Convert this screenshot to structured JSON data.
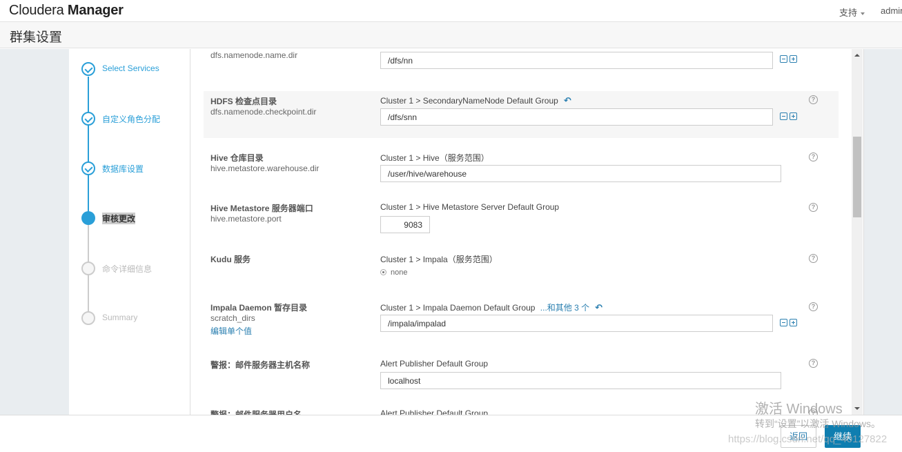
{
  "header": {
    "brand_light": "Cloudera",
    "brand_bold": "Manager",
    "support_menu": "支持",
    "user_menu": "admin"
  },
  "page": {
    "title": "群集设置"
  },
  "wizard": {
    "steps": [
      {
        "label": "Select Services",
        "state": "done"
      },
      {
        "label": "自定义角色分配",
        "state": "done"
      },
      {
        "label": "数据库设置",
        "state": "done"
      },
      {
        "label": "审核更改",
        "state": "current"
      },
      {
        "label": "命令详细信息",
        "state": "todo"
      },
      {
        "label": "Summary",
        "state": "todo"
      }
    ]
  },
  "settings": [
    {
      "name": "",
      "key": "dfs.namenode.name.dir",
      "scope": "",
      "value": "/dfs/nn",
      "multi": true
    },
    {
      "name": "HDFS 检查点目录",
      "key": "dfs.namenode.checkpoint.dir",
      "scope": "Cluster 1 > SecondaryNameNode Default Group",
      "value": "/dfs/snn",
      "multi": true,
      "undo": true
    },
    {
      "name": "Hive 仓库目录",
      "key": "hive.metastore.warehouse.dir",
      "scope": "Cluster 1 > Hive（服务范围）",
      "value": "/user/hive/warehouse"
    },
    {
      "name": "Hive Metastore 服务器端口",
      "key": "hive.metastore.port",
      "scope": "Cluster 1 > Hive Metastore Server Default Group",
      "value": "9083"
    },
    {
      "name": "Kudu 服务",
      "key": "",
      "scope": "Cluster 1 > Impala（服务范围）",
      "radio_option": "none"
    },
    {
      "name": "Impala Daemon 暂存目录",
      "key": "scratch_dirs",
      "scope": "Cluster 1 > Impala Daemon Default Group",
      "scope_more": "...和其他 3 个",
      "edit_link": "编辑单个值",
      "value": "/impala/impalad",
      "multi": true,
      "undo": true
    },
    {
      "name": "警报：邮件服务器主机名称",
      "key": "",
      "scope": "Alert Publisher Default Group",
      "value": "localhost"
    },
    {
      "name": "警报：邮件服务器用户名",
      "key": "",
      "scope": "Alert Publisher Default Group"
    }
  ],
  "icons": {
    "undo": "↶",
    "help": "?"
  },
  "footer": {
    "back_label": "返回",
    "continue_label": "继续"
  },
  "watermarks": {
    "activate_title": "激活 Windows",
    "activate_sub": "转到“设置”以激活 Windows。",
    "blog_url": "https://blog.csdn.net/qq_40127822"
  },
  "colors": {
    "accent": "#2a9fd8",
    "link": "#2a7fb0",
    "primary_button": "#0f7eb0"
  }
}
